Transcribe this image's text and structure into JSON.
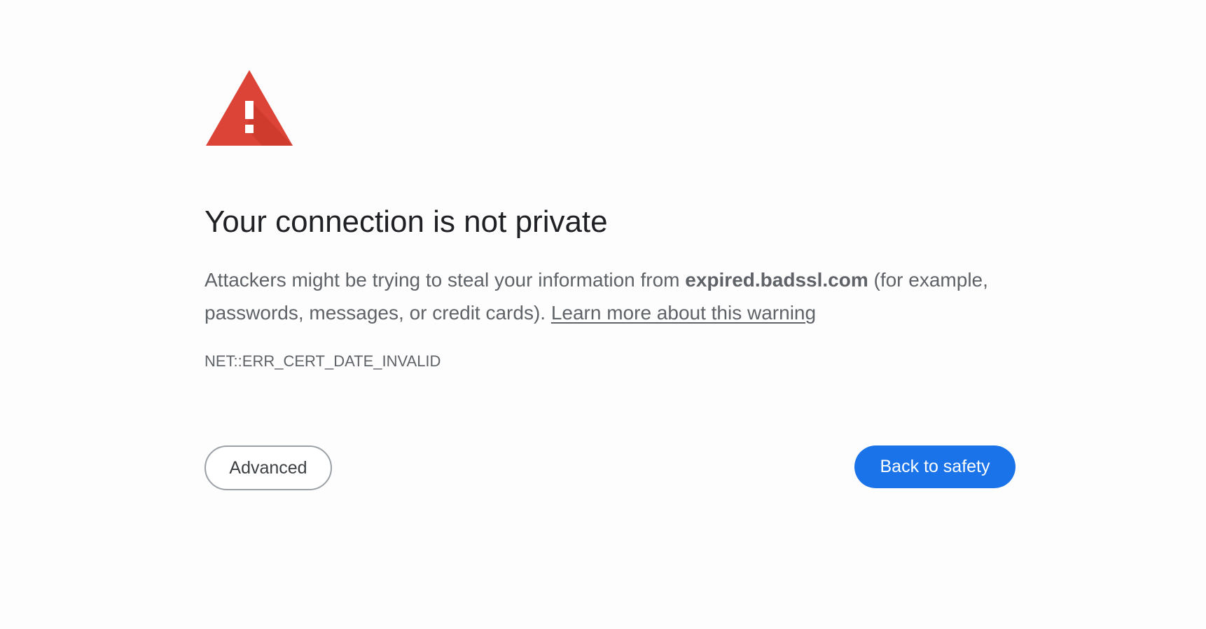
{
  "interstitial": {
    "heading": "Your connection is not private",
    "explanation": {
      "prefix": "Attackers might be trying to steal your information from ",
      "hostname": "expired.badssl.com",
      "suffix": " (for example, passwords, messages, or credit cards). ",
      "learn_more_link": "Learn more about this warning"
    },
    "error_code": "NET::ERR_CERT_DATE_INVALID",
    "buttons": {
      "advanced_label": "Advanced",
      "back_to_safety_label": "Back to safety"
    },
    "icon": "warning-triangle-icon",
    "colors": {
      "warning_red": "#db4437",
      "primary_blue": "#1a73e8",
      "heading_text": "#202124",
      "body_text": "#5f6368"
    }
  }
}
